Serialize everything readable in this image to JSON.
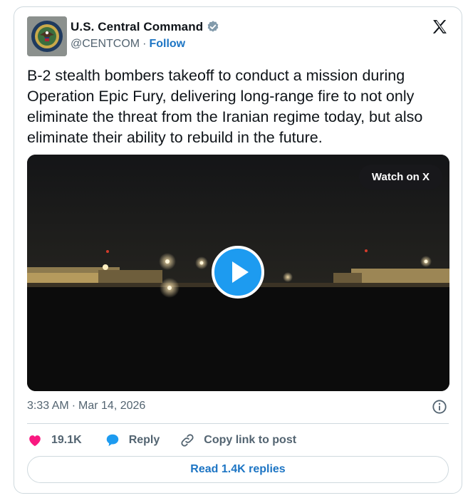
{
  "author": {
    "display_name": "U.S. Central Command",
    "handle": "@CENTCOM",
    "separator": "·",
    "follow_label": "Follow",
    "avatar_icon": "centcom-seal-icon",
    "verified_icon": "verified-badge-icon"
  },
  "platform_icon": "x-logo-icon",
  "tweet": {
    "text": "B-2 stealth bombers takeoff to conduct a mission during Operation Epic Fury, delivering long-range fire to not only eliminate the threat from the Iranian regime today, but also eliminate their ability to rebuild in the future."
  },
  "media": {
    "watch_label": "Watch on X",
    "play_icon": "play-icon"
  },
  "meta": {
    "time": "3:33 AM",
    "separator": "·",
    "date": "Mar 14, 2026",
    "info_icon": "info-icon"
  },
  "actions": {
    "like_count": "19.1K",
    "reply_label": "Reply",
    "copy_link_label": "Copy link to post"
  },
  "replies_button": {
    "label": "Read 1.4K replies"
  },
  "colors": {
    "accent_blue": "#1d9bf0",
    "link_blue": "#1d75c4",
    "like_pink": "#f91880",
    "muted_text": "#536471",
    "border": "#cfd9de"
  }
}
